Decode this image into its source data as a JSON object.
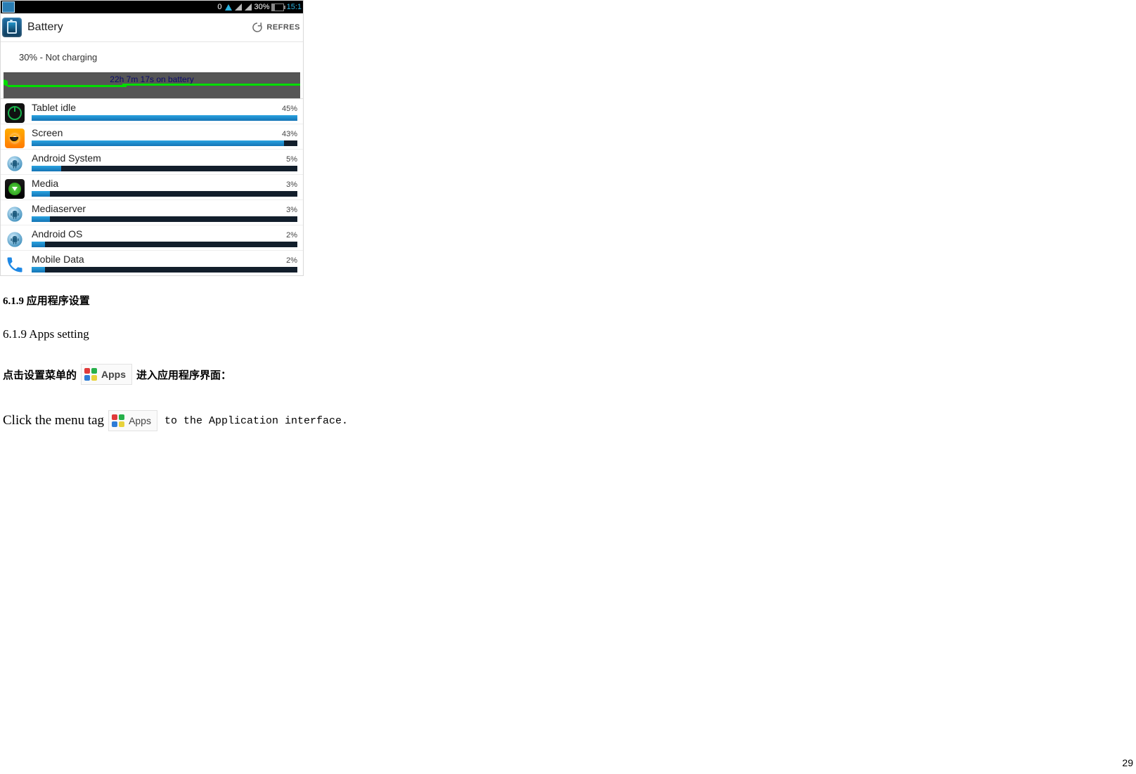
{
  "page_number": "29",
  "status_bar": {
    "bluetooth_label": "0",
    "battery_percent": "30%",
    "time": "15:1"
  },
  "battery_screen": {
    "title": "Battery",
    "refresh_label": "REFRES",
    "status": "30% - Not charging",
    "graph_caption": "22h 7m 17s on battery",
    "items": [
      {
        "name": "Tablet idle",
        "pct": "45%",
        "fill": 100
      },
      {
        "name": "Screen",
        "pct": "43%",
        "fill": 95
      },
      {
        "name": "Android System",
        "pct": "5%",
        "fill": 11
      },
      {
        "name": "Media",
        "pct": "3%",
        "fill": 7
      },
      {
        "name": "Mediaserver",
        "pct": "3%",
        "fill": 7
      },
      {
        "name": "Android OS",
        "pct": "2%",
        "fill": 5
      },
      {
        "name": "Mobile Data",
        "pct": "2%",
        "fill": 5
      }
    ]
  },
  "doc": {
    "heading_zh": "6.1.9 应用程序设置",
    "heading_en": "6.1.9 Apps setting",
    "line1_pre_zh": "点击设置菜单的",
    "line1_post_zh": " 进入应用程序界面：",
    "apps_label": "Apps",
    "line2_pre_en": "Click the menu tag",
    "line2_post_en": " to the Application interface."
  }
}
